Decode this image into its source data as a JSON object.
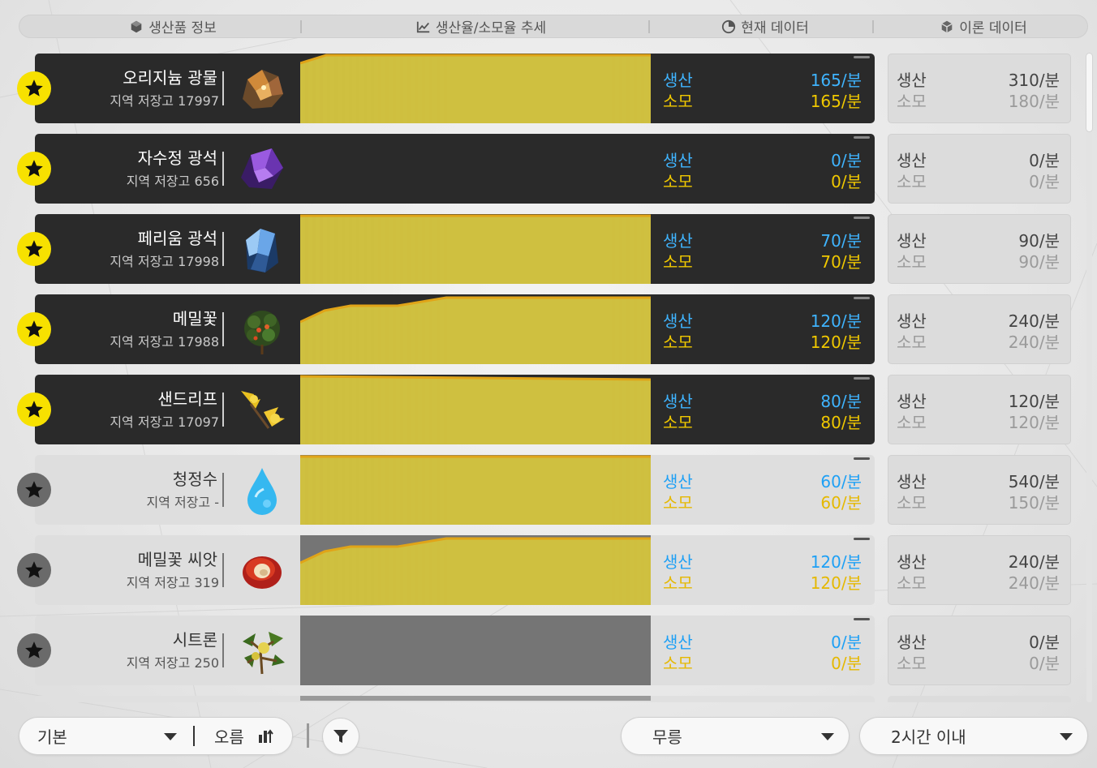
{
  "header": {
    "col1": "생산품 정보",
    "col2": "생산율/소모율 추세",
    "col3": "현재 데이터",
    "col4": "이론 데이터"
  },
  "labels": {
    "produce": "생산",
    "consume": "소모"
  },
  "items": [
    {
      "name": "오리지늄 광물",
      "stock": "지역 저장고 17997",
      "favorite": true,
      "active": true,
      "icon": "originium-ore-icon",
      "produce": "165/분",
      "consume": "165/분",
      "theory_produce": "310/분",
      "theory_consume": "180/분"
    },
    {
      "name": "자수정 광석",
      "stock": "지역 저장고 656",
      "favorite": true,
      "active": true,
      "icon": "amethyst-ore-icon",
      "produce": "0/분",
      "consume": "0/분",
      "theory_produce": "0/분",
      "theory_consume": "0/분"
    },
    {
      "name": "페리움 광석",
      "stock": "지역 저장고 17998",
      "favorite": true,
      "active": true,
      "icon": "ferrium-ore-icon",
      "produce": "70/분",
      "consume": "70/분",
      "theory_produce": "90/분",
      "theory_consume": "90/분"
    },
    {
      "name": "메밀꽃",
      "stock": "지역 저장고 17988",
      "favorite": true,
      "active": true,
      "icon": "buckwheat-flower-icon",
      "produce": "120/분",
      "consume": "120/분",
      "theory_produce": "240/분",
      "theory_consume": "240/분"
    },
    {
      "name": "샌드리프",
      "stock": "지역 저장고 17097",
      "favorite": true,
      "active": true,
      "icon": "sandleaf-icon",
      "produce": "80/분",
      "consume": "80/분",
      "theory_produce": "120/분",
      "theory_consume": "120/분"
    },
    {
      "name": "청정수",
      "stock": "지역 저장고 -",
      "favorite": false,
      "active": false,
      "icon": "clean-water-icon",
      "produce": "60/분",
      "consume": "60/분",
      "theory_produce": "540/분",
      "theory_consume": "150/분"
    },
    {
      "name": "메밀꽃 씨앗",
      "stock": "지역 저장고 319",
      "favorite": false,
      "active": false,
      "icon": "buckwheat-seed-icon",
      "produce": "120/분",
      "consume": "120/분",
      "theory_produce": "240/분",
      "theory_consume": "240/분"
    },
    {
      "name": "시트론",
      "stock": "지역 저장고 250",
      "favorite": false,
      "active": false,
      "icon": "citron-icon",
      "produce": "0/분",
      "consume": "0/분",
      "theory_produce": "0/분",
      "theory_consume": "0/분"
    }
  ],
  "toolbar": {
    "sort_value": "기본",
    "order_label": "오름",
    "region_value": "무릉",
    "time_value": "2시간 이내"
  },
  "colors": {
    "accent_yellow": "#f7e100",
    "produce_blue": "#3fb4ff",
    "consume_yellow": "#f0c800",
    "chart_fill": "#cfc040"
  }
}
